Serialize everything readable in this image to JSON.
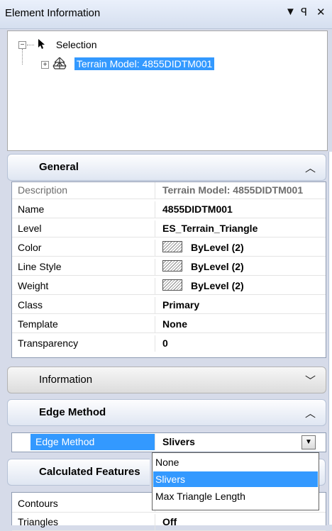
{
  "panel": {
    "title": "Element Information",
    "dropdown_glyph": "▼",
    "pin_glyph": "ꟼ",
    "close_glyph": "✕"
  },
  "tree": {
    "root_label": "Selection",
    "child_label": "Terrain Model: 4855DIDTM001"
  },
  "sections": {
    "general": {
      "title": "General",
      "rows": [
        {
          "name": "Description",
          "value": "Terrain Model: 4855DIDTM001"
        },
        {
          "name": "Name",
          "value": "4855DIDTM001"
        },
        {
          "name": "Level",
          "value": "ES_Terrain_Triangle"
        },
        {
          "name": "Color",
          "value": "ByLevel (2)"
        },
        {
          "name": "Line Style",
          "value": "ByLevel (2)"
        },
        {
          "name": "Weight",
          "value": "ByLevel (2)"
        },
        {
          "name": "Class",
          "value": "Primary"
        },
        {
          "name": "Template",
          "value": "None"
        },
        {
          "name": "Transparency",
          "value": "0"
        }
      ]
    },
    "information": {
      "title": "Information"
    },
    "edge_method": {
      "title": "Edge Method",
      "row": {
        "name": "Edge Method",
        "value": "Slivers"
      },
      "options": [
        "None",
        "Slivers",
        "Max Triangle Length"
      ],
      "selected": "Slivers"
    },
    "calculated": {
      "title": "Calculated Features",
      "rows": [
        {
          "name": "Contours",
          "value": ""
        },
        {
          "name": "Triangles",
          "value": "Off"
        }
      ]
    }
  },
  "icons": {
    "collapse": "chevron-up-icon",
    "expand": "chevron-down-icon",
    "pointer": "arrow-pointer-icon",
    "terrain": "terrain-model-icon",
    "swatch": "line-style-swatch-icon"
  },
  "colors": {
    "selection": "#3399ff",
    "header_bg": "#dfe6f2"
  }
}
